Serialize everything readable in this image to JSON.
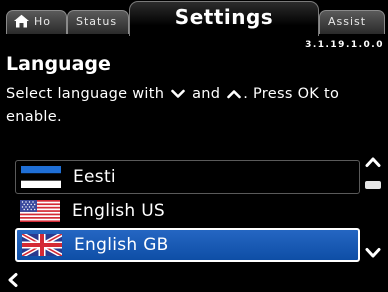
{
  "tabs": {
    "home_label": "Ho",
    "status_label": "Status",
    "settings_label": "Settings",
    "assist_label": "Assist"
  },
  "version": "3.1.19.1.0.0",
  "heading": "Language",
  "instruction": {
    "part1": "Select language with",
    "part2": "and",
    "part3": ". Press OK to enable."
  },
  "languages": [
    {
      "label": "Eesti",
      "flag": "estonia-flag",
      "state": "default"
    },
    {
      "label": "English US",
      "flag": "us-flag",
      "state": "default"
    },
    {
      "label": "English GB",
      "flag": "uk-flag",
      "state": "selected"
    }
  ],
  "icons": {
    "home": "house-icon",
    "down": "chevron-down-icon",
    "up": "chevron-up-icon",
    "back": "chevron-left-icon"
  },
  "colors": {
    "selection": "#1a5cb8",
    "background": "#000000",
    "text": "#ffffff"
  }
}
